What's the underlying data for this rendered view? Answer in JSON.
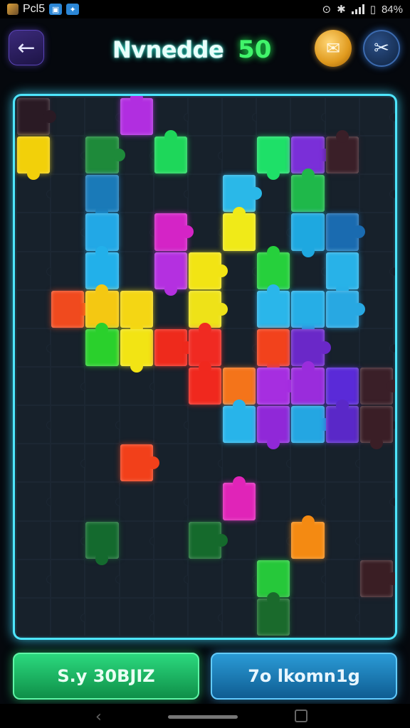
{
  "status_bar": {
    "time": "Pcl5",
    "battery": "84%"
  },
  "header": {
    "title": "Nvnedde",
    "level": "50",
    "back_icon": "arrow-left-icon",
    "coin_icon": "scroll-coin-icon",
    "settings_icon": "tools-icon"
  },
  "board": {
    "cols": 11,
    "rows": 14,
    "pieces": [
      {
        "c": 0,
        "r": 0,
        "color": "#2a1a24"
      },
      {
        "c": 3,
        "r": 0,
        "color": "#b12ee0"
      },
      {
        "c": 0,
        "r": 1,
        "color": "#f2d00a"
      },
      {
        "c": 2,
        "r": 1,
        "color": "#1e8a3a"
      },
      {
        "c": 4,
        "r": 1,
        "color": "#1ed75a"
      },
      {
        "c": 7,
        "r": 1,
        "color": "#1ee068"
      },
      {
        "c": 8,
        "r": 1,
        "color": "#7a2fd8"
      },
      {
        "c": 9,
        "r": 1,
        "color": "#3a1f28"
      },
      {
        "c": 2,
        "r": 2,
        "color": "#1a7ab8"
      },
      {
        "c": 6,
        "r": 2,
        "color": "#2ab8e8"
      },
      {
        "c": 8,
        "r": 2,
        "color": "#1fb84a"
      },
      {
        "c": 2,
        "r": 3,
        "color": "#22a8e6"
      },
      {
        "c": 4,
        "r": 3,
        "color": "#d424c6"
      },
      {
        "c": 6,
        "r": 3,
        "color": "#f0ea18"
      },
      {
        "c": 8,
        "r": 3,
        "color": "#1ea8e0"
      },
      {
        "c": 9,
        "r": 3,
        "color": "#1a6bb0"
      },
      {
        "c": 2,
        "r": 4,
        "color": "#22b0ea"
      },
      {
        "c": 4,
        "r": 4,
        "color": "#b430e0"
      },
      {
        "c": 5,
        "r": 4,
        "color": "#f2e414"
      },
      {
        "c": 7,
        "r": 4,
        "color": "#26d03c"
      },
      {
        "c": 9,
        "r": 4,
        "color": "#28b2e8"
      },
      {
        "c": 1,
        "r": 5,
        "color": "#f04a1e"
      },
      {
        "c": 2,
        "r": 5,
        "color": "#f4c812"
      },
      {
        "c": 3,
        "r": 5,
        "color": "#f4d614"
      },
      {
        "c": 5,
        "r": 5,
        "color": "#eee218"
      },
      {
        "c": 7,
        "r": 5,
        "color": "#2ab6ea"
      },
      {
        "c": 8,
        "r": 5,
        "color": "#26aee6"
      },
      {
        "c": 9,
        "r": 5,
        "color": "#28a8e2"
      },
      {
        "c": 2,
        "r": 6,
        "color": "#2ad02c"
      },
      {
        "c": 3,
        "r": 6,
        "color": "#f2e414"
      },
      {
        "c": 4,
        "r": 6,
        "color": "#ee2a1c"
      },
      {
        "c": 5,
        "r": 6,
        "color": "#f02a22"
      },
      {
        "c": 7,
        "r": 6,
        "color": "#f2421c"
      },
      {
        "c": 8,
        "r": 6,
        "color": "#6a28c8"
      },
      {
        "c": 5,
        "r": 7,
        "color": "#f0281e"
      },
      {
        "c": 6,
        "r": 7,
        "color": "#f4741a"
      },
      {
        "c": 7,
        "r": 7,
        "color": "#a62ee0"
      },
      {
        "c": 8,
        "r": 7,
        "color": "#9a2cdc"
      },
      {
        "c": 9,
        "r": 7,
        "color": "#5a2ad8"
      },
      {
        "c": 10,
        "r": 7,
        "color": "#3a1f28"
      },
      {
        "c": 6,
        "r": 8,
        "color": "#28b4ea"
      },
      {
        "c": 7,
        "r": 8,
        "color": "#9028d8"
      },
      {
        "c": 8,
        "r": 8,
        "color": "#24a6e2"
      },
      {
        "c": 9,
        "r": 8,
        "color": "#5a28c8"
      },
      {
        "c": 10,
        "r": 8,
        "color": "#3a1e26"
      },
      {
        "c": 3,
        "r": 9,
        "color": "#f2401a"
      },
      {
        "c": 6,
        "r": 10,
        "color": "#e024b8"
      },
      {
        "c": 2,
        "r": 11,
        "color": "#146a2e"
      },
      {
        "c": 5,
        "r": 11,
        "color": "#156a2c"
      },
      {
        "c": 8,
        "r": 11,
        "color": "#f48a12"
      },
      {
        "c": 7,
        "r": 12,
        "color": "#26c83a"
      },
      {
        "c": 10,
        "r": 12,
        "color": "#3a1e24"
      },
      {
        "c": 7,
        "r": 13,
        "color": "#1a6a2c"
      }
    ]
  },
  "buttons": {
    "left_label": "S.y 30BJIZ",
    "right_label": "7o lkomn1g"
  },
  "navbar": {
    "back_icon": "nav-back-icon",
    "home_icon": "nav-home-icon",
    "recent_icon": "nav-recent-icon"
  }
}
